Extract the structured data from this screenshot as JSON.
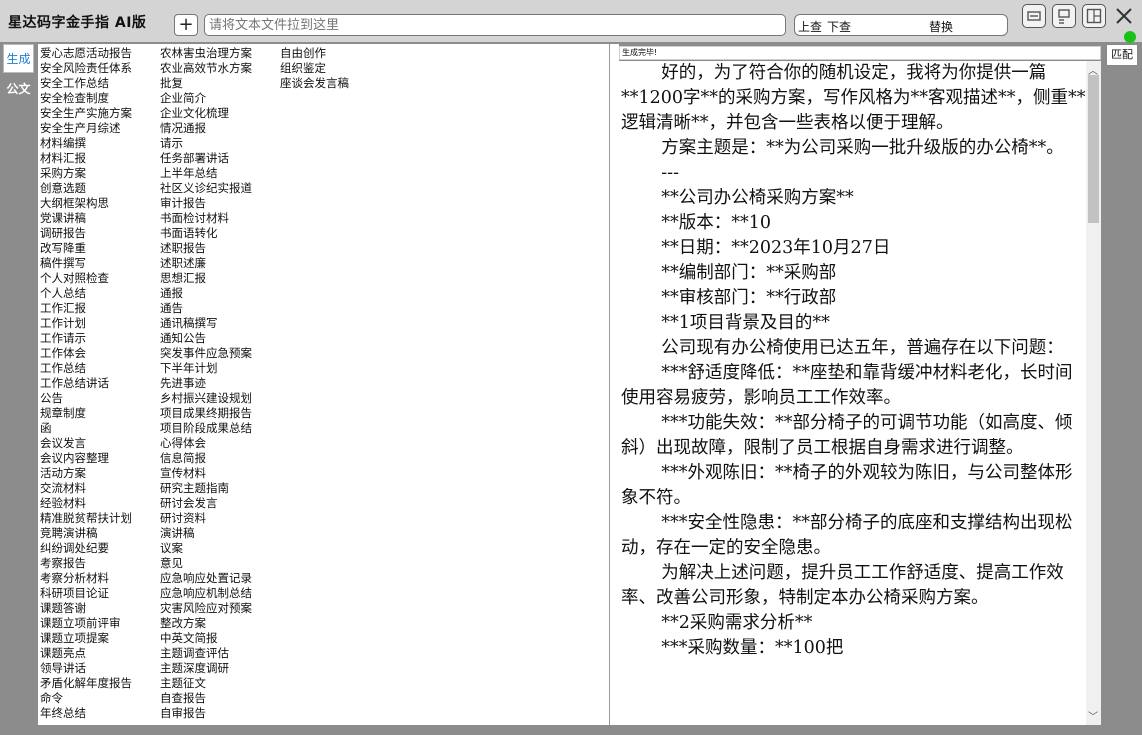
{
  "app": {
    "title": "星达码字金手指 AI版",
    "add_label": "+",
    "drop_placeholder": "请将文本文件拉到这里",
    "search": {
      "up": "上查",
      "down": "下查",
      "replace": "替换"
    }
  },
  "category_tabs": [
    "生成",
    "公文"
  ],
  "templates": {
    "col1": [
      "爱心志愿活动报告",
      "安全风险责任体系",
      "安全工作总结",
      "安全检查制度",
      "安全生产实施方案",
      "安全生产月综述",
      "材料编撰",
      "材料汇报",
      "采购方案",
      "创意选题",
      "大纲框架构思",
      "党课讲稿",
      "调研报告",
      "改写降重",
      "稿件撰写",
      "个人对照检查",
      "个人总结",
      "工作汇报",
      "工作计划",
      "工作请示",
      "工作体会",
      "工作总结",
      "工作总结讲话",
      "公告",
      "规章制度",
      "函",
      "会议发言",
      "会议内容整理",
      "活动方案",
      "交流材料",
      "经验材料",
      "精准脱贫帮扶计划",
      "竞聘演讲稿",
      "纠纷调处纪要",
      "考察报告",
      "考察分析材料",
      "科研项目论证",
      "课题答谢",
      "课题立项前评审",
      "课题立项提案",
      "课题亮点",
      "领导讲话",
      "矛盾化解年度报告",
      "命令",
      "年终总结"
    ],
    "col2": [
      "农林害虫治理方案",
      "农业高效节水方案",
      "批复",
      "企业简介",
      "企业文化梳理",
      "情况通报",
      "请示",
      "任务部署讲话",
      "上半年总结",
      "社区义诊纪实报道",
      "审计报告",
      "书面检讨材料",
      "书面语转化",
      "述职报告",
      "述职述廉",
      "思想汇报",
      "通报",
      "通告",
      "通讯稿撰写",
      "通知公告",
      "突发事件应急预案",
      "下半年计划",
      "先进事迹",
      "乡村振兴建设规划",
      "项目成果终期报告",
      "项目阶段成果总结",
      "心得体会",
      "信息简报",
      "宣传材料",
      "研究主题指南",
      "研讨会发言",
      "研讨资料",
      "演讲稿",
      "议案",
      "意见",
      "应急响应处置记录",
      "应急响应机制总结",
      "灾害风险应对预案",
      "整改方案",
      "中英文简报",
      "主题调查评估",
      "主题深度调研",
      "主题征文",
      "自查报告",
      "自审报告"
    ],
    "col3": [
      "自由创作",
      "组织鉴定",
      "座谈会发言稿"
    ]
  },
  "status_text": "生成完毕!",
  "match_label": "匹配",
  "output_paragraphs": [
    "好的，为了符合你的随机设定，我将为你提供一篇**1200字**的采购方案，写作风格为**客观描述**，侧重**逻辑清晰**，并包含一些表格以便于理解。",
    "方案主题是：**为公司采购一批升级版的办公椅**。",
    "---",
    "**公司办公椅采购方案**",
    "**版本：**10",
    "**日期：**2023年10月27日",
    "**编制部门：**采购部",
    "**审核部门：**行政部",
    "**1项目背景及目的**",
    "公司现有办公椅使用已达五年，普遍存在以下问题：",
    "***舒适度降低：**座垫和靠背缓冲材料老化，长时间使用容易疲劳，影响员工工作效率。",
    "***功能失效：**部分椅子的可调节功能（如高度、倾斜）出现故障，限制了员工根据自身需求进行调整。",
    "***外观陈旧：**椅子的外观较为陈旧，与公司整体形象不符。",
    "***安全性隐患：**部分椅子的底座和支撑结构出现松动，存在一定的安全隐患。",
    "为解决上述问题，提升员工工作舒适度、提高工作效率、改善公司形象，特制定本办公椅采购方案。",
    "**2采购需求分析**",
    "***采购数量：**100把"
  ]
}
